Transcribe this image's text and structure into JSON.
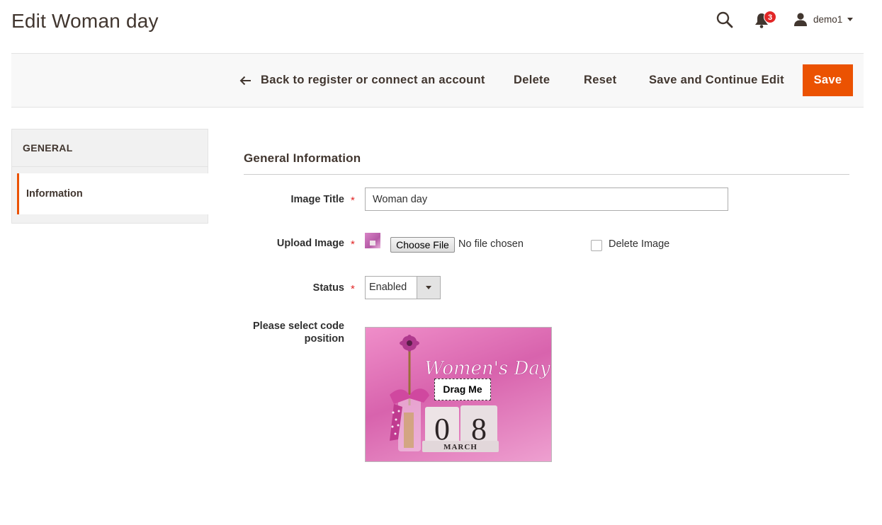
{
  "page": {
    "title": "Edit Woman day"
  },
  "header": {
    "notifications_count": "3",
    "user_name": "demo1"
  },
  "toolbar": {
    "back_label": "Back to register or connect an account",
    "delete_label": "Delete",
    "reset_label": "Reset",
    "save_continue_label": "Save and Continue Edit",
    "save_label": "Save"
  },
  "sidebar": {
    "heading": "GENERAL",
    "items": [
      {
        "label": "Information",
        "active": true
      }
    ]
  },
  "form": {
    "section_title": "General Information",
    "image_title": {
      "label": "Image Title",
      "value": "Woman day",
      "required": true
    },
    "upload_image": {
      "label": "Upload Image",
      "required": true,
      "button_label": "Choose File",
      "file_status": "No file chosen",
      "delete_label": "Delete Image",
      "delete_checked": false
    },
    "status": {
      "label": "Status",
      "value": "Enabled",
      "required": true
    },
    "code_position": {
      "label_line1": "Please select code",
      "label_line2": "position",
      "drag_label": "Drag Me"
    }
  },
  "preview_image": {
    "headline": "Women's Day",
    "day": "08",
    "month": "MARCH"
  },
  "colors": {
    "accent": "#eb5202",
    "badge": "#e22626",
    "required": "#e22626",
    "text": "#41362f"
  },
  "icons": [
    "search-icon",
    "bell-icon",
    "user-icon",
    "arrow-left-icon",
    "chevron-down-icon"
  ]
}
